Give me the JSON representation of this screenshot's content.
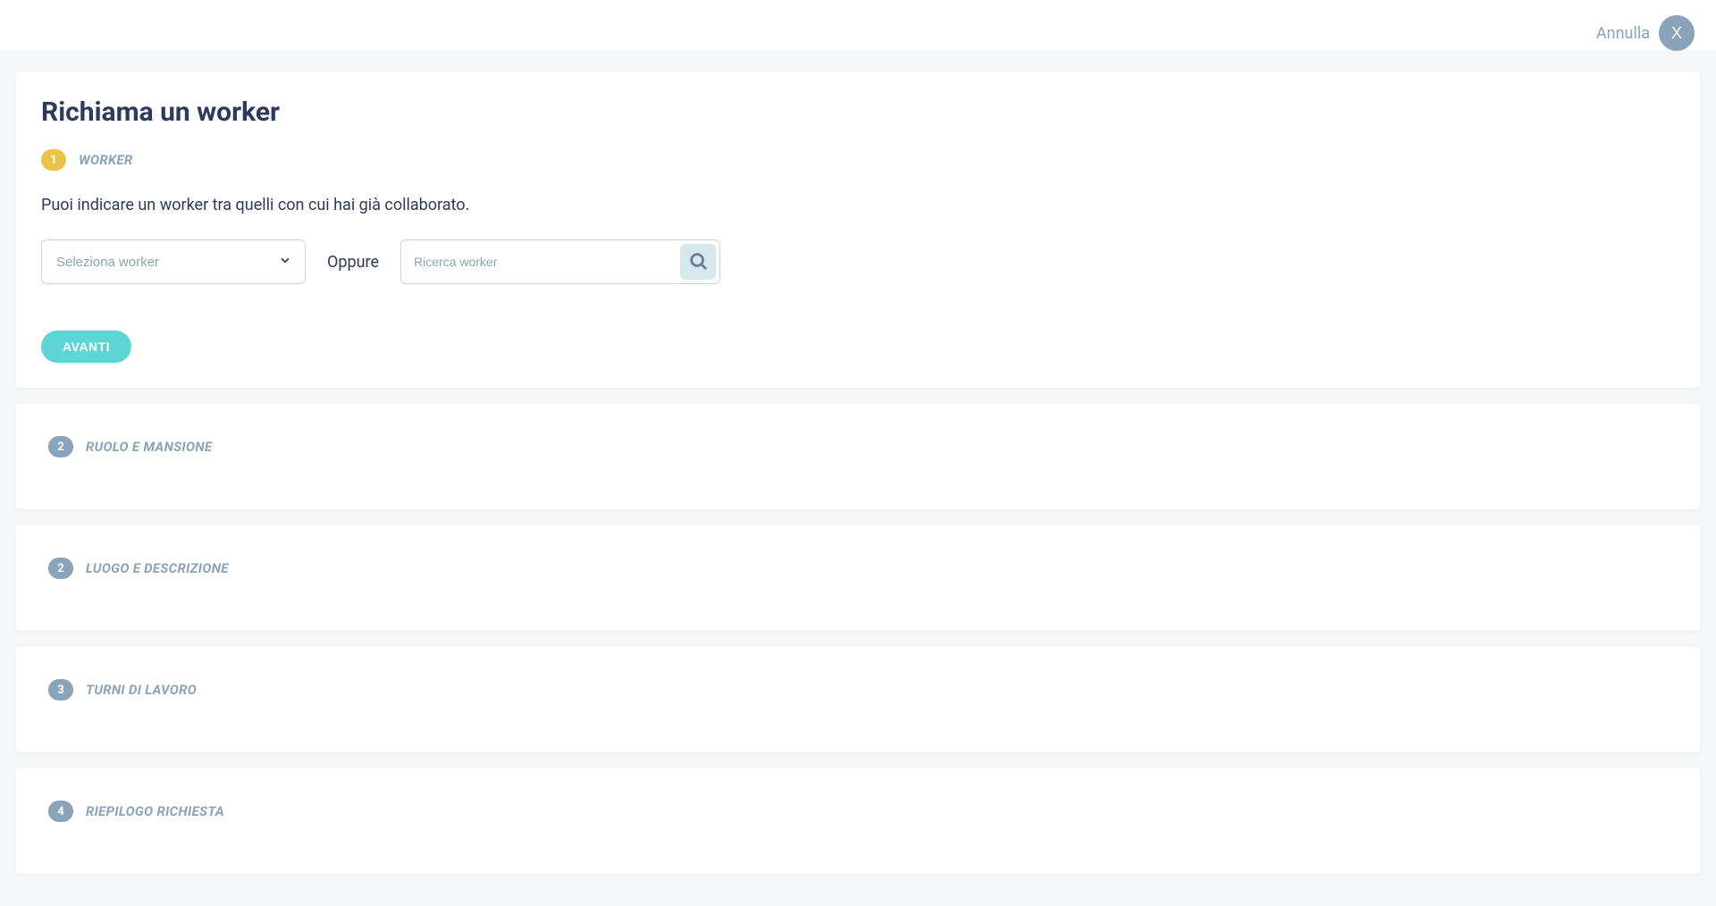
{
  "header": {
    "cancel_label": "Annulla",
    "close_label": "X"
  },
  "page": {
    "title": "Richiama un worker"
  },
  "step1": {
    "badge": "1",
    "label": "WORKER",
    "description": "Puoi indicare un worker tra quelli con cui hai già collaborato.",
    "select_placeholder": "Seleziona worker",
    "or_label": "Oppure",
    "search_placeholder": "Ricerca worker",
    "next_label": "AVANTI"
  },
  "step2": {
    "badge": "2",
    "label": "RUOLO E MANSIONE"
  },
  "step3": {
    "badge": "2",
    "label": "LUOGO E DESCRIZIONE"
  },
  "step4": {
    "badge": "3",
    "label": "TURNI DI LAVORO"
  },
  "step5": {
    "badge": "4",
    "label": "RIEPILOGO RICHIESTA"
  }
}
